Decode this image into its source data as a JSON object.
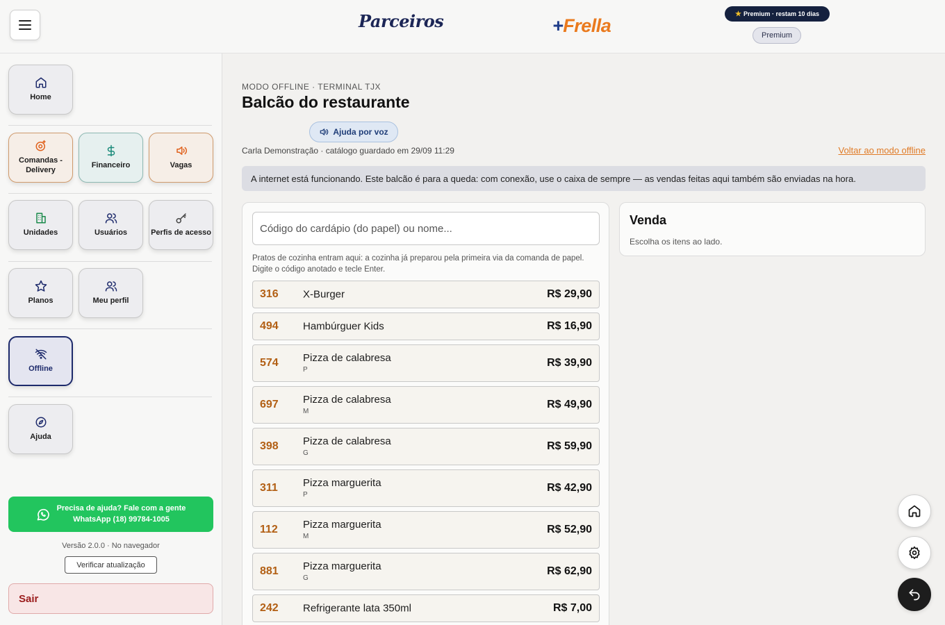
{
  "header": {
    "logo_parceiros": "Parceiros",
    "logo_frella_plus": "+",
    "logo_frella_name": "Frella",
    "premium_badge": "Premium · restam 10 dias",
    "premium_pill": "Premium"
  },
  "sidebar": {
    "tiles": {
      "home": "Home",
      "comandas": "Comandas - Delivery",
      "financeiro": "Financeiro",
      "vagas": "Vagas",
      "unidades": "Unidades",
      "usuarios": "Usuários",
      "perfis": "Perfis de acesso",
      "planos": "Planos",
      "meu_perfil": "Meu perfil",
      "offline": "Offline",
      "ajuda": "Ajuda"
    },
    "whatsapp_line1": "Precisa de ajuda? Fale com a gente",
    "whatsapp_line2": "WhatsApp (18) 99784-1005",
    "version": "Versão 2.0.0 · No navegador",
    "update_label": "Verificar atualização",
    "logout_label": "Sair"
  },
  "main": {
    "eyebrow": "MODO OFFLINE · TERMINAL TJX",
    "title": "Balcão do restaurante",
    "voice_help": "Ajuda por voz",
    "meta": "Carla Demonstração · catálogo guardado em 29/09 11:29",
    "back_link": "Voltar ao modo offline",
    "notice": "A internet está funcionando. Este balcão é para a queda: com conexão, use o caixa de sempre — as vendas feitas aqui também são enviadas na hora."
  },
  "catalog": {
    "search_placeholder": "Código do cardápio (do papel) ou nome...",
    "help_text": "Pratos de cozinha entram aqui: a cozinha já preparou pela primeira via da comanda de papel. Digite o código anotado e tecle Enter.",
    "items": [
      {
        "code": "316",
        "name": "X-Burger",
        "size": "",
        "price": "R$ 29,90"
      },
      {
        "code": "494",
        "name": "Hambúrguer Kids",
        "size": "",
        "price": "R$ 16,90"
      },
      {
        "code": "574",
        "name": "Pizza de calabresa",
        "size": "P",
        "price": "R$ 39,90"
      },
      {
        "code": "697",
        "name": "Pizza de calabresa",
        "size": "M",
        "price": "R$ 49,90"
      },
      {
        "code": "398",
        "name": "Pizza de calabresa",
        "size": "G",
        "price": "R$ 59,90"
      },
      {
        "code": "311",
        "name": "Pizza marguerita",
        "size": "P",
        "price": "R$ 42,90"
      },
      {
        "code": "112",
        "name": "Pizza marguerita",
        "size": "M",
        "price": "R$ 52,90"
      },
      {
        "code": "881",
        "name": "Pizza marguerita",
        "size": "G",
        "price": "R$ 62,90"
      },
      {
        "code": "242",
        "name": "Refrigerante lata 350ml",
        "size": "",
        "price": "R$ 7,00"
      }
    ]
  },
  "sale": {
    "title": "Venda",
    "subtitle": "Escolha os itens ao lado."
  },
  "colors": {
    "accent_orange": "#e07a25",
    "navy": "#1d2a6b",
    "whatsapp_green": "#22c55e",
    "code_brown": "#b25f14"
  }
}
